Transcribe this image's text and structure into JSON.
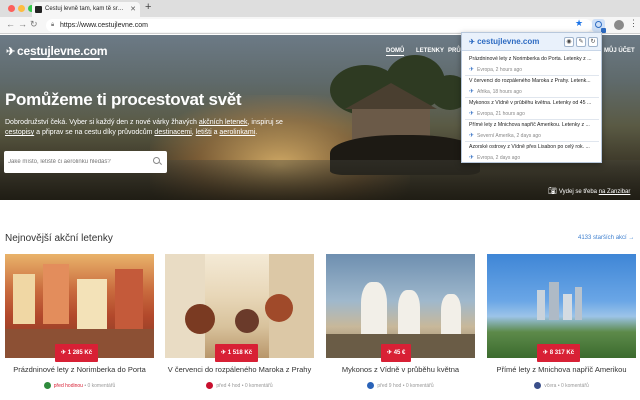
{
  "browser": {
    "tab_title": "Cestuj levně tam, kam tě srdce",
    "url": "https://www.cestujlevne.com"
  },
  "site": {
    "logo": "cestujlevne.com",
    "nav": [
      "DOMŮ",
      "LETENKY",
      "PRŮ",
      "MŮJ ÚČET"
    ],
    "headline": "Pomůžeme ti procestovat svět",
    "intro": {
      "p1": "Dobrodružství čeká. Vyber si každý den z nové várky žhavých ",
      "l1": "akčních letenek",
      "p2": ", inspiruj se ",
      "l2": "cestopisy",
      "p3": " a připrav se na cestu díky průvodcům ",
      "l3": "destinacemi",
      "p4": ", ",
      "l4": "letišti",
      "p5": " a ",
      "l5": "aerolinkami",
      "p6": "."
    },
    "search_placeholder": "Jaké místo, letiště či aerolinku hledáš?",
    "photo_credit": {
      "text": "Vydej se třeba ",
      "link": "na Zanzibar"
    },
    "section_title": "Nejnovější akční letenky",
    "older_link": "4133 starších akcí →"
  },
  "deals": [
    {
      "title": "Prázdninové lety z Norimberka do Porta",
      "price": "✈ 1 285 Kč",
      "when": "před hodinou",
      "comments": "• 0 komentářů",
      "flag_color": "#e0392b"
    },
    {
      "title": "V červenci do rozpáleného Maroka z Prahy",
      "price": "✈ 1 518 Kč",
      "when": "před 4 hod",
      "comments": "• 0 komentářů",
      "flag_color": "#d02020"
    },
    {
      "title": "Mykonos z Vídně v průběhu května",
      "price": "✈ 45 €",
      "when": "před 9 hod",
      "comments": "• 0 komentářů",
      "flag_color": "#2a63b8"
    },
    {
      "title": "Přímé lety z Mnichova napříč Amerikou",
      "price": "✈ 8 317 Kč",
      "when": "včera",
      "comments": "• 0 komentářů",
      "flag_color": "#3a4f8a"
    }
  ],
  "popup": {
    "logo": "cestujlevne.com",
    "items": [
      {
        "title": "Prázdninové lety z Norimberka do Porta. Letenky z ...",
        "region": "Evropa",
        "time": "2 hours ago"
      },
      {
        "title": "V červenci do rozpáleného Maroka z Prahy. Letenk...",
        "region": "Afrika",
        "time": "18 hours ago"
      },
      {
        "title": "Mykonos z Vídně v průběhu května. Letenky od 45 ...",
        "region": "Evropa",
        "time": "21 hours ago"
      },
      {
        "title": "Přímé lety z Mnichova napříč Amerikou. Letenky z ...",
        "region": "Severní Amerika",
        "time": "2 days ago"
      },
      {
        "title": "Azorské ostrovy z Vídně přes Lisabon po celý rok. ...",
        "region": "Evropa",
        "time": "2 days ago"
      }
    ]
  }
}
